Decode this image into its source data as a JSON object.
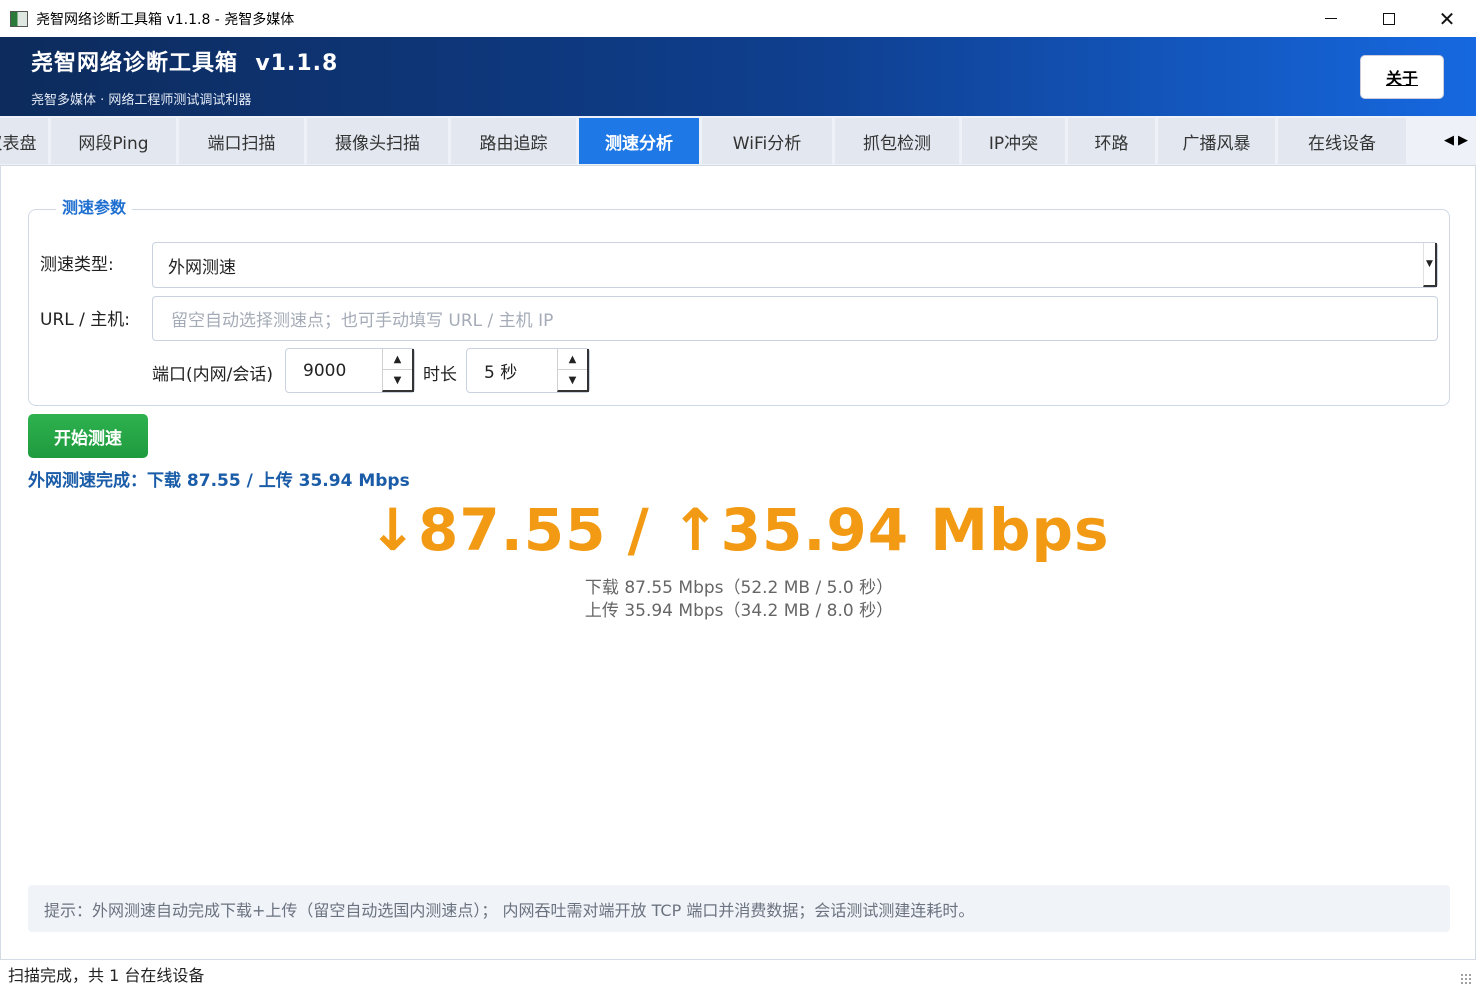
{
  "window": {
    "title": "尧智网络诊断工具箱 v1.1.8 - 尧智多媒体",
    "min_icon": "minimize-icon",
    "max_icon": "maximize-icon",
    "close_glyph": "✕"
  },
  "header": {
    "app_name": "尧智网络诊断工具箱  v1.1.8",
    "subtitle": "尧智多媒体 · 网络工程师测试调试利器",
    "about_label": "关于"
  },
  "tabs": [
    {
      "label": "仪表盘",
      "active": false
    },
    {
      "label": "网段Ping",
      "active": false
    },
    {
      "label": "端口扫描",
      "active": false
    },
    {
      "label": "摄像头扫描",
      "active": false
    },
    {
      "label": "路由追踪",
      "active": false
    },
    {
      "label": "测速分析",
      "active": true
    },
    {
      "label": "WiFi分析",
      "active": false
    },
    {
      "label": "抓包检测",
      "active": false
    },
    {
      "label": "IP冲突",
      "active": false
    },
    {
      "label": "环路",
      "active": false
    },
    {
      "label": "广播风暴",
      "active": false
    },
    {
      "label": "在线设备",
      "active": false
    }
  ],
  "tab_scroll": {
    "left": "◀",
    "right": "▶"
  },
  "params": {
    "group_title": "测速参数",
    "type_label": "测速类型:",
    "type_value": "外网测速",
    "url_label": "URL / 主机:",
    "url_placeholder": "留空自动选择测速点；也可手动填写 URL / 主机 IP",
    "port_label": "端口(内网/会话)",
    "port_value": "9000",
    "duration_label": "时长",
    "duration_value": "5 秒",
    "spin_up": "▲",
    "spin_down": "▼",
    "select_caret": "▼"
  },
  "actions": {
    "start_label": "开始测速"
  },
  "result": {
    "status": "外网测速完成：下载 87.55 / 上传 35.94 Mbps",
    "headline": "↓87.55 / ↑35.94 Mbps",
    "download_detail": "下载 87.55 Mbps（52.2 MB / 5.0 秒）",
    "upload_detail": "上传 35.94 Mbps（34.2 MB / 8.0 秒）",
    "accent_color": "#f29a13"
  },
  "hint": "提示：外网测速自动完成下载+上传（留空自动选国内测速点）； 内网吞吐需对端开放 TCP 端口并消费数据；会话测试测建连耗时。",
  "statusbar": {
    "text": "扫描完成，共 1 台在线设备"
  }
}
